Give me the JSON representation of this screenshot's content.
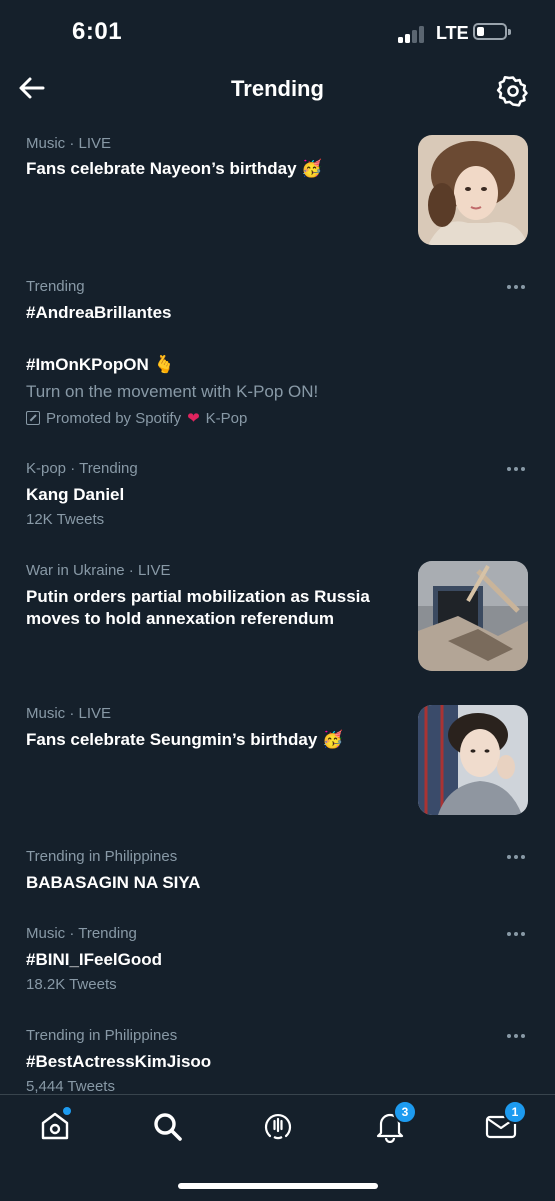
{
  "status_bar": {
    "time": "6:01",
    "network": "LTE"
  },
  "header": {
    "title": "Trending"
  },
  "trends": [
    {
      "meta": "Music · LIVE",
      "title": "Fans celebrate Nayeon’s birthday",
      "emoji": "🥳",
      "thumbnail": "portrait-photo"
    },
    {
      "meta": "Trending",
      "title": "#AndreaBrillantes"
    },
    {
      "title": "#ImOnKPopON",
      "emoji": "🫰",
      "description": "Turn on the movement with K-Pop ON!",
      "promoted": "Promoted by Spotify",
      "promoted_tail": "K-Pop"
    },
    {
      "meta": "K-pop · Trending",
      "title": "Kang Daniel",
      "count": "12K Tweets"
    },
    {
      "meta": "War in Ukraine · LIVE",
      "title_line1": "Putin orders partial mobilization as Russia",
      "title_line2": "moves to hold annexation referendum",
      "thumbnail": "rubble-photo"
    },
    {
      "meta": "Music · LIVE",
      "title": "Fans celebrate Seungmin’s birthday",
      "emoji": "🥳",
      "thumbnail": "portrait-photo"
    },
    {
      "meta": "Trending in Philippines",
      "title": "BABASAGIN NA SIYA"
    },
    {
      "meta": "Music · Trending",
      "title": "#BINI_IFeelGood",
      "count": "18.2K Tweets"
    },
    {
      "meta": "Trending in Philippines",
      "title": "#BestActressKimJisoo",
      "count": "5,444 Tweets"
    }
  ],
  "tab_bar": {
    "tabs": [
      {
        "name": "home",
        "icon": "home-icon"
      },
      {
        "name": "search",
        "icon": "search-icon"
      },
      {
        "name": "spaces",
        "icon": "spaces-icon"
      },
      {
        "name": "notifications",
        "icon": "bell-icon",
        "badge": "3"
      },
      {
        "name": "messages",
        "icon": "mail-icon",
        "badge": "1"
      }
    ]
  },
  "colors": {
    "background": "#15202b",
    "secondary_text": "#8899a6",
    "accent": "#1d9bf0",
    "divider": "#38444d"
  }
}
